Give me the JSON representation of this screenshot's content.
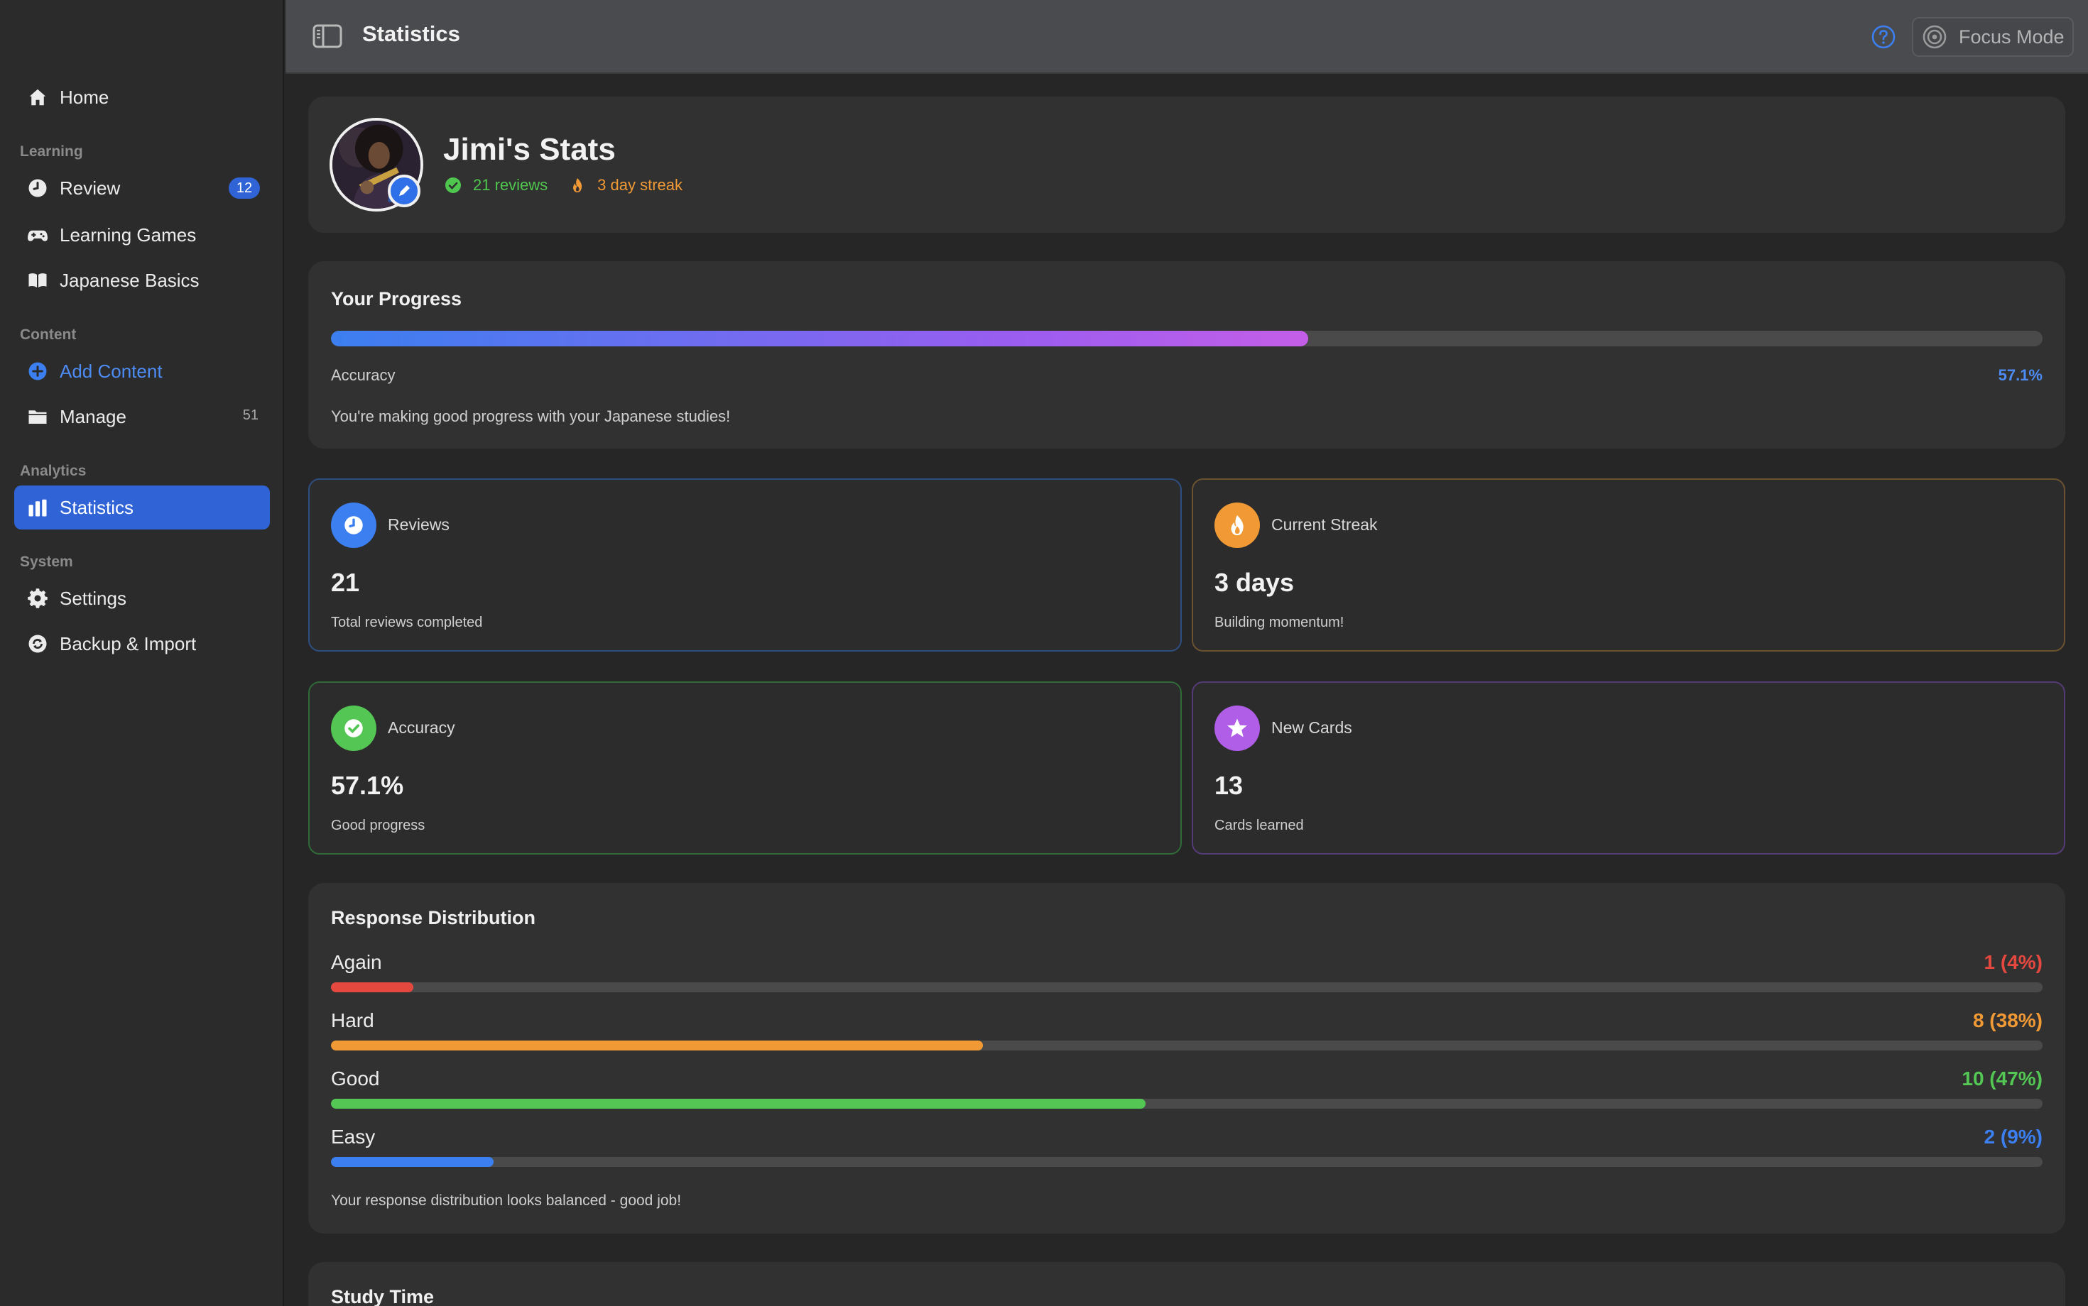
{
  "sidebar": {
    "home": "Home",
    "sections": {
      "learning": "Learning",
      "content": "Content",
      "analytics": "Analytics",
      "system": "System"
    },
    "review": {
      "label": "Review",
      "badge": "12"
    },
    "learning_games": "Learning Games",
    "japanese_basics": "Japanese Basics",
    "add_content": "Add Content",
    "manage": {
      "label": "Manage",
      "count": "51"
    },
    "statistics": "Statistics",
    "settings": "Settings",
    "backup_import": "Backup & Import"
  },
  "topbar": {
    "title": "Statistics",
    "focus_mode": "Focus Mode"
  },
  "profile": {
    "name": "Jimi's Stats",
    "reviews": "21 reviews",
    "streak": "3 day streak"
  },
  "progress": {
    "title": "Your Progress",
    "fraction": 0.571,
    "accuracy_label": "Accuracy",
    "accuracy_value": "57.1%",
    "note": "You're making good progress with your Japanese studies!"
  },
  "cards": {
    "reviews": {
      "label": "Reviews",
      "value": "21",
      "sub": "Total reviews completed"
    },
    "streak": {
      "label": "Current Streak",
      "value": "3 days",
      "sub": "Building momentum!"
    },
    "accuracy": {
      "label": "Accuracy",
      "value": "57.1%",
      "sub": "Good progress"
    },
    "new_cards": {
      "label": "New Cards",
      "value": "13",
      "sub": "Cards learned"
    }
  },
  "distribution": {
    "title": "Response Distribution",
    "rows": [
      {
        "label": "Again",
        "value": "1 (4%)",
        "fraction": 0.048,
        "color": "#e5483f"
      },
      {
        "label": "Hard",
        "value": "8 (38%)",
        "fraction": 0.381,
        "color": "#f19a35"
      },
      {
        "label": "Good",
        "value": "10 (47%)",
        "fraction": 0.476,
        "color": "#53c653"
      },
      {
        "label": "Easy",
        "value": "2 (9%)",
        "fraction": 0.095,
        "color": "#3b7ff0"
      }
    ],
    "note": "Your response distribution looks balanced - good job!"
  },
  "study_time": {
    "title": "Study Time"
  },
  "colors": {
    "accent": "#2f63d6",
    "link": "#4d8cf5",
    "reviews_card": "#3b7ff0",
    "streak_card": "#f19a35",
    "accuracy_card": "#53c653",
    "new_cards_card": "#b05ee8"
  },
  "icons": {
    "home": "house-icon",
    "review": "clock-icon",
    "games": "gamepad-icon",
    "basics": "book-icon",
    "add": "plus-circle-icon",
    "manage": "folder-icon",
    "statistics": "bar-chart-icon",
    "settings": "gear-icon",
    "backup": "sync-icon"
  }
}
